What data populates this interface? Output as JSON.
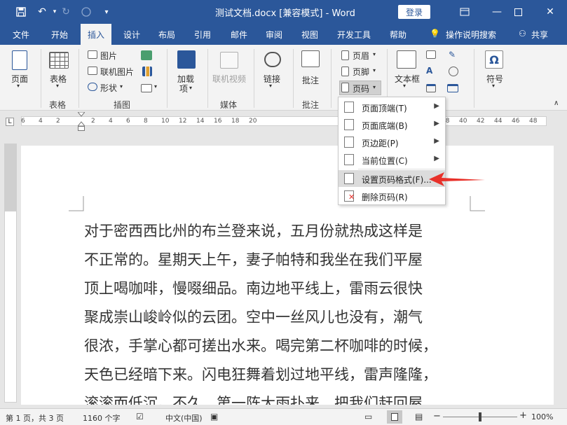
{
  "titlebar": {
    "title": "测试文档.docx [兼容模式] - Word",
    "login_label": "登录",
    "icons": [
      "save-icon",
      "undo-icon",
      "redo-icon",
      "touch-mode-icon",
      "customize-icon"
    ],
    "controls": [
      "restore-ribbon-icon",
      "minimize-icon",
      "maximize-icon",
      "close-icon"
    ]
  },
  "tabs": [
    {
      "label": "文件"
    },
    {
      "label": "开始"
    },
    {
      "label": "插入"
    },
    {
      "label": "设计"
    },
    {
      "label": "布局"
    },
    {
      "label": "引用"
    },
    {
      "label": "邮件"
    },
    {
      "label": "审阅"
    },
    {
      "label": "视图"
    },
    {
      "label": "开发工具"
    },
    {
      "label": "帮助"
    }
  ],
  "tell_me": "操作说明搜索",
  "share": "共享",
  "ribbon": {
    "pages_label": "页面",
    "table_label": "表格",
    "table_group": "表格",
    "picture_label": "图片",
    "online_picture_label": "联机图片",
    "shapes_label": "形状",
    "illustrations_group": "插图",
    "addins_label": "加载",
    "addins_label2": "项",
    "online_video_label": "联机视频",
    "media_group": "媒体",
    "links_label": "链接",
    "comment_label": "批注",
    "comments_group": "批注",
    "header_label": "页眉",
    "footer_label": "页脚",
    "pagenum_label": "页码",
    "textbox_label": "文本框",
    "symbol_label": "符号"
  },
  "menu": {
    "items": [
      {
        "label": "页面顶端(T)",
        "submenu": true
      },
      {
        "label": "页面底端(B)",
        "submenu": true
      },
      {
        "label": "页边距(P)",
        "submenu": true
      },
      {
        "label": "当前位置(C)",
        "submenu": true
      },
      {
        "label": "设置页码格式(F)...",
        "submenu": false,
        "highlighted": true
      },
      {
        "label": "删除页码(R)",
        "submenu": false
      }
    ]
  },
  "ruler": {
    "numbers": [
      "6",
      "4",
      "2",
      "",
      "2",
      "4",
      "6",
      "8",
      "10",
      "12",
      "14",
      "16",
      "18",
      "20",
      "",
      "",
      "",
      "",
      "",
      "",
      "",
      "",
      "",
      "",
      "38",
      "40",
      "42",
      "44",
      "46",
      "48"
    ]
  },
  "document": {
    "lines": [
      "对于密西西比州的布兰登来说，五月份就热成这样是",
      "不正常的。星期天上午，妻子帕特和我坐在我们平屋",
      "顶上喝咖啡，慢啜细品。南边地平线上，雷雨云很快",
      "聚成崇山峻岭似的云团。空中一丝风儿也没有，潮气",
      "很浓，手掌心都可搓出水来。喝完第二杯咖啡的时候，",
      "天色已经暗下来。闪电狂舞着划过地平线，雷声隆隆，",
      "滚滚而低沉。不久，第一阵大雨扑来，把我们赶回屋"
    ]
  },
  "status": {
    "page": "第 1 页，共 3 页",
    "words": "1160 个字",
    "language": "中文(中国)",
    "zoom": "100%"
  },
  "colors": {
    "brand": "#2b579a",
    "arrow": "#e8312a"
  }
}
